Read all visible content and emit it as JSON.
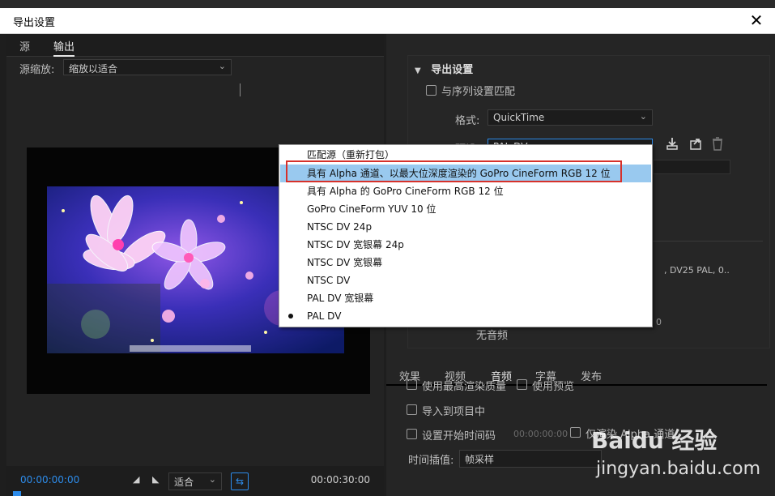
{
  "window": {
    "title": "导出设置",
    "close_glyph": "✕"
  },
  "left": {
    "tabs": [
      "源",
      "输出"
    ],
    "scale_label": "源缩放:",
    "scale_value": "缩放以适合",
    "timecode_in": "00:00:00:00",
    "timecode_out": "00:00:30:00",
    "fit_value": "适合"
  },
  "right": {
    "section_title": "导出设置",
    "match_sequence": "与序列设置匹配",
    "format_label": "格式:",
    "format_value": "QuickTime",
    "preset_label": "预设:",
    "preset_value": "PAL DV",
    "summary_text": ", DV25 PAL, 0..",
    "summary_num": "0",
    "no_audio": "无音频",
    "tabs": [
      "效果",
      "视频",
      "音频",
      "字幕",
      "发布"
    ],
    "max_quality": "使用最高渲染质量",
    "use_preview": "使用预览",
    "import_project": "导入到项目中",
    "set_start_tc": "设置开始时间码",
    "start_tc_value": "00:00:00:00",
    "render_alpha": "仅渲染 Alpha 通道",
    "interp_label": "时间插值:",
    "interp_value": "帧采样"
  },
  "preset_menu": {
    "items": [
      "匹配源（重新打包）",
      "具有 Alpha 通道、以最大位深度渲染的 GoPro CineForm RGB 12 位",
      "具有 Alpha 的 GoPro CineForm RGB 12 位",
      "GoPro CineForm YUV 10 位",
      "NTSC DV 24p",
      "NTSC DV 宽银幕 24p",
      "NTSC DV 宽银幕",
      "NTSC DV",
      "PAL DV 宽银幕",
      "PAL DV"
    ],
    "highlighted_index": 1,
    "current_index": 9,
    "annotation_color": "#d6312b"
  },
  "watermark": {
    "logo": "Baidu 经验",
    "url": "jingyan.baidu.com"
  },
  "colors": {
    "accent": "#2d8ceb",
    "highlight": "#99c9ef"
  }
}
